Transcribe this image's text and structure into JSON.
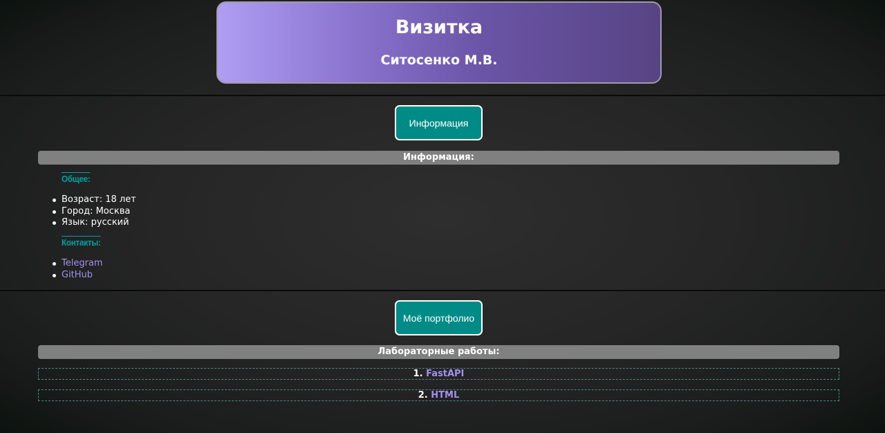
{
  "header": {
    "title": "Визитка",
    "subtitle": "Ситосенко М.В."
  },
  "info_section": {
    "button_label": "Информация",
    "bar_title": "Информация:",
    "general_heading": "Общее:",
    "general_items": [
      "Возраст: 18 лет",
      "Город: Москва",
      "Язык: русский"
    ],
    "contacts_heading": "Контакты:",
    "contacts": [
      "Telegram",
      "GitHub"
    ]
  },
  "portfolio_section": {
    "button_label": "Моё портфолио",
    "bar_title": "Лабораторные работы:",
    "labs": [
      {
        "number": "1.",
        "name": "FastAPI"
      },
      {
        "number": "2.",
        "name": "HTML"
      }
    ]
  },
  "colors": {
    "accent_teal": "#008b87",
    "link_purple": "#a58ff0",
    "bar_gray": "#808080"
  }
}
